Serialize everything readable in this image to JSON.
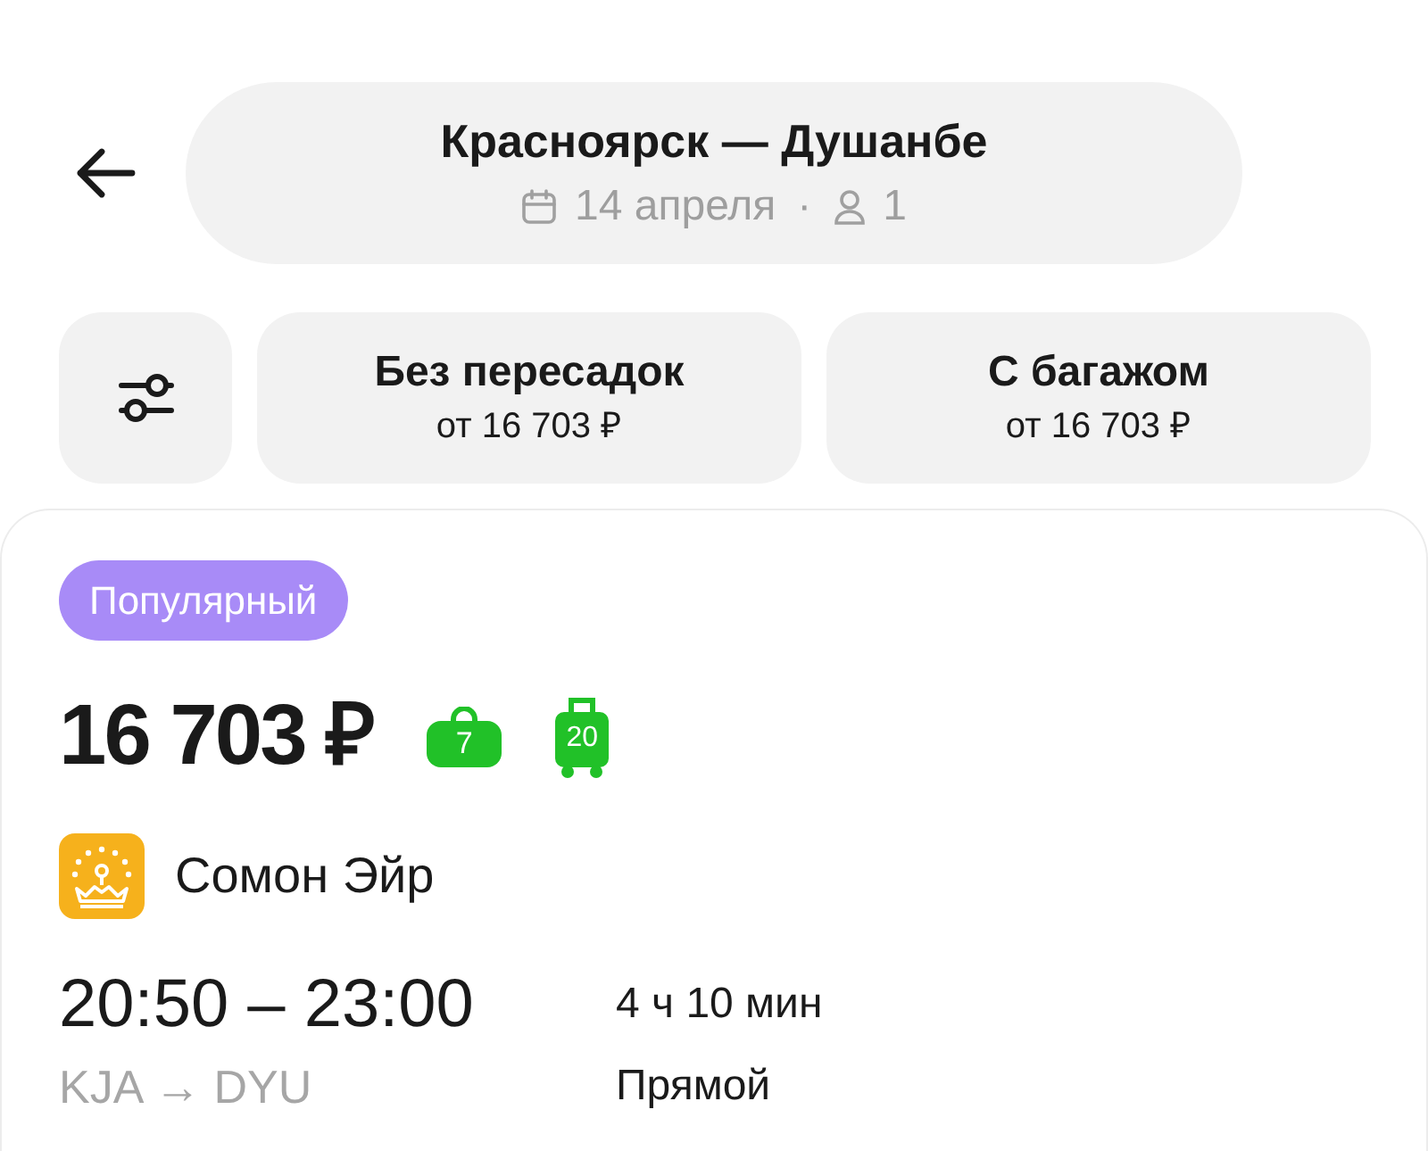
{
  "header": {
    "route": "Красноярск — Душанбе",
    "date": "14 апреля",
    "separator": "·",
    "passengers": "1"
  },
  "filter_chips": [
    {
      "title": "Без пересадок",
      "subtitle": "от 16 703 ₽",
      "selected": false
    },
    {
      "title": "С багажом",
      "subtitle": "от 16 703 ₽",
      "selected": false
    }
  ],
  "offer": {
    "badge": "Популярный",
    "price": "16 703 ₽",
    "baggage": [
      {
        "kind": "hand",
        "weight": "7",
        "included": true
      },
      {
        "kind": "checked",
        "weight": "20",
        "included": true
      }
    ],
    "airline": "Сомон Эйр",
    "times": "20:50 – 23:00",
    "route_codes": "KJA → DYU",
    "duration": "4 ч 10 мин",
    "stops": "Прямой"
  }
}
